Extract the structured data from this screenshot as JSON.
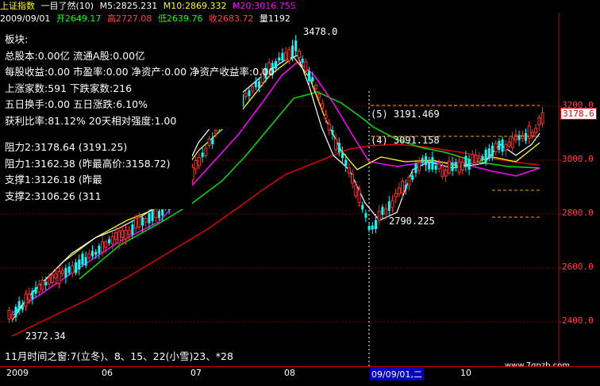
{
  "header": {
    "index_name": "上证指数",
    "view_mode": "一目了然(10)",
    "m5": "M5:2825.231",
    "m10": "M10:2869.332",
    "m20": "M20:3016.755",
    "date": "2009/09/01",
    "open": "开2649.17",
    "high": "高2727.08",
    "low": "低2639.76",
    "close": "收2683.72",
    "volume": "量1192"
  },
  "info_panel": {
    "rows": [
      "板块:",
      "总股本:0.00亿  流通A股:0.00亿",
      "每股收益:0.00  市盈率:0.00  净资产:0.00  净资产收益率:0.00",
      "上涨家数:591   下跌家数:216",
      "五日换手:0.00  五日涨跌:6.10%",
      "获利比率:81.12%  20天相对强度:1.00"
    ],
    "levels": [
      "阻力2:3178.64  (3191.25)",
      "阻力1:3162.38  (昨最高价:3158.72)",
      "支撑1:3126.18  (昨最",
      "支撑2:3106.26  (311"
    ]
  },
  "y_axis": {
    "ticks": [
      "3200.0",
      "3000.0",
      "2800.0",
      "2600.0",
      "2400.0"
    ],
    "current_price": "3178.6"
  },
  "annotations": {
    "peak": "3478.0",
    "low": "2372.34",
    "trough": "2790.225",
    "fib_levels": [
      "(5) 3191.469",
      "(4) 3091.158"
    ]
  },
  "date_axis": {
    "labels": [
      "2009",
      "06",
      "07",
      "08",
      "09/09/01,二",
      "10"
    ]
  },
  "window_note": "11月时间之窗:7(立冬)、8、15、22(小雪)23、*28",
  "watermark": "www.7gpzb.com",
  "colors": {
    "up": "#ff3030",
    "down": "#00ffff",
    "ma5": "#ffffff",
    "ma10": "#ffff00",
    "ma20": "#ff00ff",
    "ma60": "#00e000",
    "ma120": "#e00000"
  }
}
